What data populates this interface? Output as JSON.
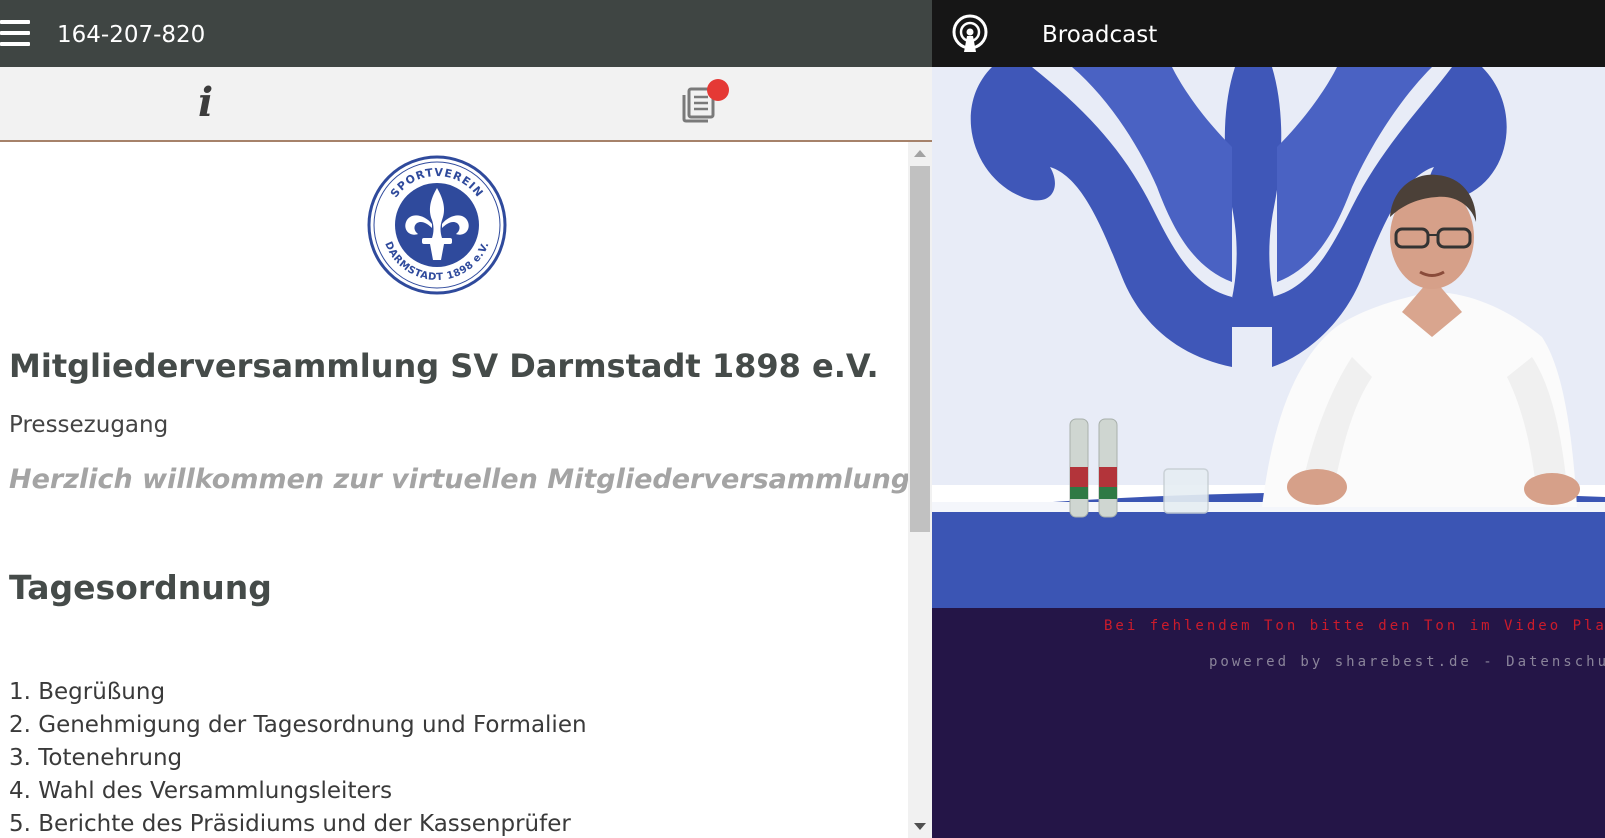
{
  "header": {
    "session_id": "164-207-820"
  },
  "tabs": [
    {
      "name": "info",
      "icon": "info-icon",
      "glyph": "i"
    },
    {
      "name": "news",
      "icon": "newspaper-icon",
      "has_notification": true
    }
  ],
  "content": {
    "logo": {
      "top_text": "SPORTVEREIN",
      "bottom_text": "DARMSTADT 1898 e.V."
    },
    "title": "Mitgliederversammlung SV Darmstadt 1898 e.V.",
    "subtitle": "Pressezugang",
    "welcome": "Herzlich willkommen zur virtuellen Mitgliederversammlung",
    "section_title": "Tagesordnung",
    "agenda": [
      "1. Begrüßung",
      "2. Genehmigung der Tagesordnung und Formalien",
      "3. Totenehrung",
      "4. Wahl des Versammlungsleiters",
      "5. Berichte des Präsidiums und der Kassenprüfer"
    ]
  },
  "broadcast": {
    "title": "Broadcast",
    "notice": "Bei fehlendem Ton bitte den Ton im Video Player",
    "powered_by": "powered by sharebest.de - Datenschutz"
  },
  "colors": {
    "topbar": "#3f4543",
    "right_bar": "#161616",
    "right_panel": "#241547",
    "notice": "#cc1b2b",
    "notification_dot": "#e53935",
    "club_blue": "#2f4a9c"
  }
}
